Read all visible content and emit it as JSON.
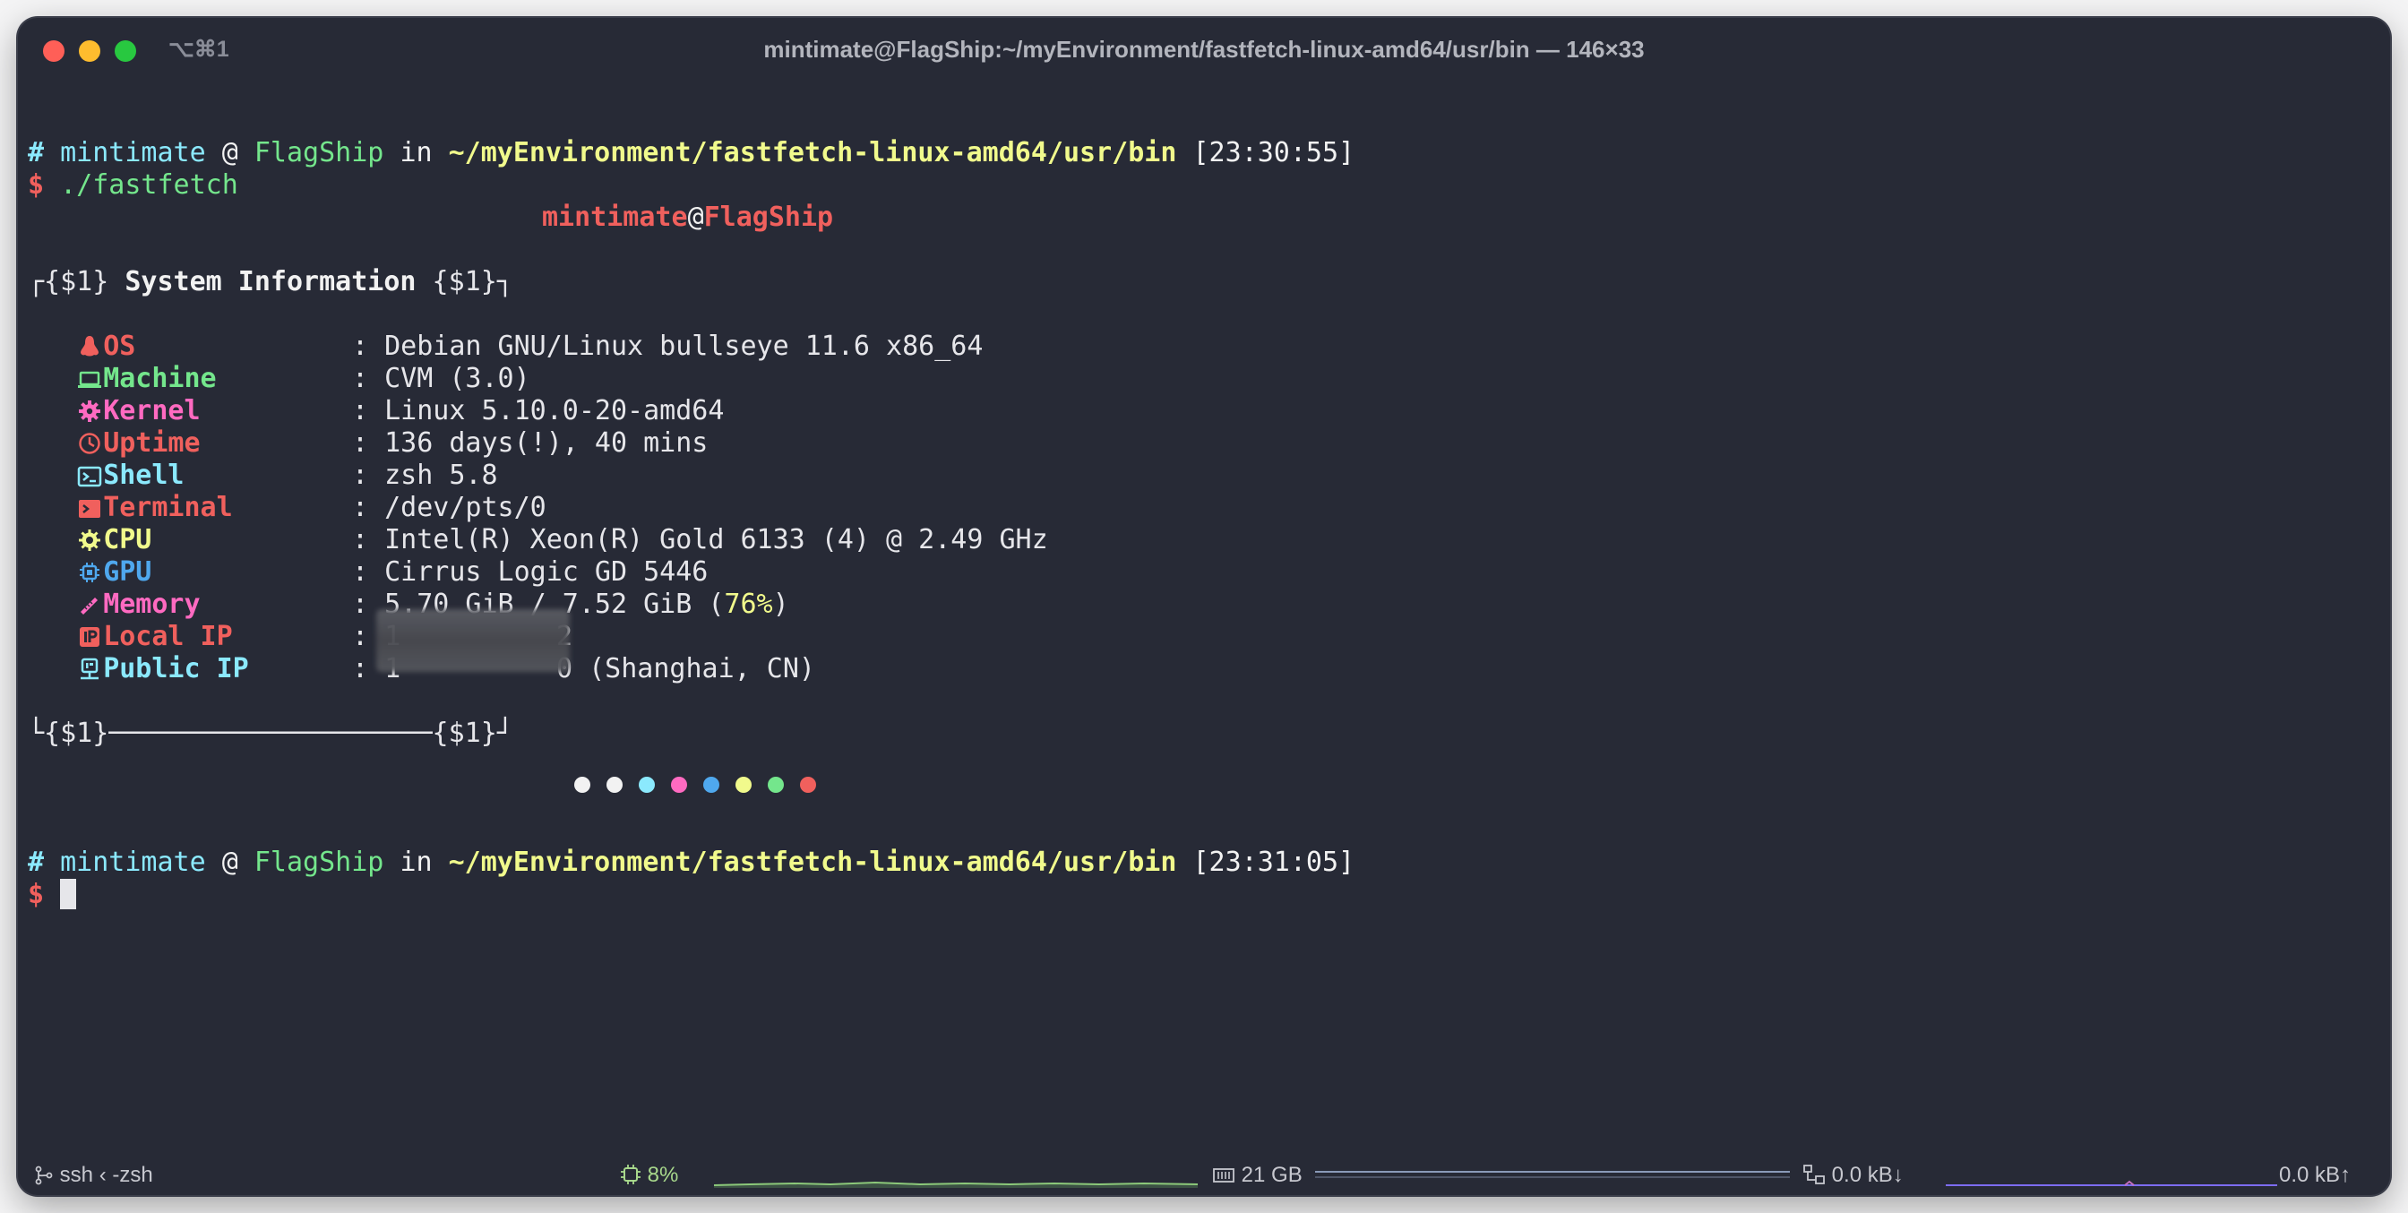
{
  "window": {
    "title": "mintimate@FlagShip:~/myEnvironment/fastfetch-linux-amd64/usr/bin — 146×33",
    "shortcut": "⌥⌘1",
    "traffic_lights": [
      "#ff5f57",
      "#febc2e",
      "#28c840"
    ]
  },
  "prompt1": {
    "hash": "#",
    "user": "mintimate",
    "at": "@",
    "host": "FlagShip",
    "in": "in",
    "path": "~/myEnvironment/fastfetch-linux-amd64/usr/bin",
    "time": "[23:30:55]"
  },
  "command": {
    "dollar": "$",
    "text": "./fastfetch"
  },
  "fastfetch": {
    "user": "mintimate",
    "at": "@",
    "host": "FlagShip",
    "header_left": "┌{$1}",
    "header_title": "System Information",
    "header_right": "{$1}┐",
    "footer": "└{$1}────────────────────{$1}┘",
    "separator": ":",
    "rows": [
      {
        "key": "OS",
        "value": "Debian GNU/Linux bullseye 11.6 x86_64",
        "icon": "linux-penguin-icon",
        "color": "#f0605d"
      },
      {
        "key": "Machine",
        "value": "CVM (3.0)",
        "icon": "laptop-icon",
        "color": "#74e68c"
      },
      {
        "key": "Kernel",
        "value": "Linux 5.10.0-20-amd64",
        "icon": "gear-icon",
        "color": "#ff6ac1"
      },
      {
        "key": "Uptime",
        "value": "136 days(!), 40 mins",
        "icon": "clock-icon",
        "color": "#f0605d"
      },
      {
        "key": "Shell",
        "value": "zsh 5.8",
        "icon": "terminal-icon",
        "color": "#8be9fd"
      },
      {
        "key": "Terminal",
        "value": "/dev/pts/0",
        "icon": "console-icon",
        "color": "#f0605d"
      },
      {
        "key": "CPU",
        "value": "Intel(R) Xeon(R) Gold 6133 (4) @ 2.49 GHz",
        "icon": "cpu-icon",
        "color": "#f1fa8c"
      },
      {
        "key": "GPU",
        "value": "Cirrus Logic GD 5446",
        "icon": "chip-icon",
        "color": "#4fa8ee"
      },
      {
        "key": "Memory",
        "value_prefix": "5.70 GiB / 7.52 GiB (",
        "value_pct": "76%",
        "value_suffix": ")",
        "icon": "memory-icon",
        "color": "#ff6ac1"
      },
      {
        "key": "Local IP",
        "value": "1",
        "value_tail": "2",
        "icon": "ip-icon",
        "color": "#f0605d"
      },
      {
        "key": "Public IP",
        "value": "1",
        "value_tail": "0 (Shanghai, CN)",
        "icon": "network-icon",
        "color": "#8be9fd"
      }
    ],
    "palette": [
      "#f2f2f2",
      "#f2f2f2",
      "#8be9fd",
      "#ff6ac1",
      "#4fa8ee",
      "#f1fa8c",
      "#74e68c",
      "#f0605d"
    ]
  },
  "prompt2": {
    "hash": "#",
    "user": "mintimate",
    "at": "@",
    "host": "FlagShip",
    "in": "in",
    "path": "~/myEnvironment/fastfetch-linux-amd64/usr/bin",
    "time": "[23:31:05]",
    "dollar": "$"
  },
  "statusbar": {
    "session": "ssh ‹ -zsh",
    "cpu": "8%",
    "memory": "21 GB",
    "net_down": "0.0 kB↓",
    "net_up": "0.0 kB↑"
  }
}
